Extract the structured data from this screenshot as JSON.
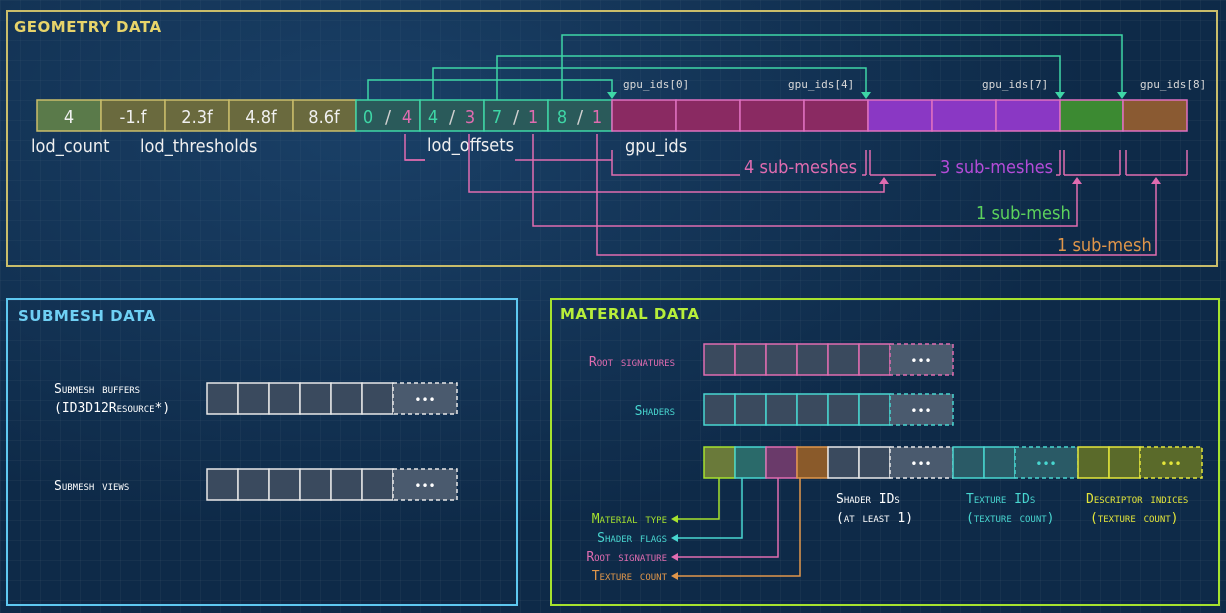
{
  "geometry": {
    "title": "GEOMETRY DATA",
    "lod_count_value": "4",
    "thresholds": [
      "-1.f",
      "2.3f",
      "4.8f",
      "8.6f"
    ],
    "offset_pairs": [
      [
        "0",
        "4"
      ],
      [
        "4",
        "3"
      ],
      [
        "7",
        "1"
      ],
      [
        "8",
        "1"
      ]
    ],
    "labels": {
      "lod_count": "lod_count",
      "lod_thresholds": "lod_thresholds",
      "lod_offsets": "lod_offsets",
      "gpu_ids": "gpu_ids"
    },
    "gpu_index_labels": [
      "gpu_ids[0]",
      "gpu_ids[4]",
      "gpu_ids[7]",
      "gpu_ids[8]"
    ],
    "group_labels": [
      "4 sub-meshes",
      "3 sub-meshes",
      "1 sub-mesh",
      "1 sub-mesh"
    ]
  },
  "submesh": {
    "title": "SUBMESH DATA",
    "buffers_label": [
      "Submesh buffers",
      "(ID3D12Resource*)"
    ],
    "views_label": "Submesh views",
    "ellipsis": "•••"
  },
  "material": {
    "title": "MATERIAL DATA",
    "root_signatures": "Root signatures",
    "shaders": "Shaders",
    "shader_ids": [
      "Shader IDs",
      "(at least 1)"
    ],
    "texture_ids": [
      "Texture IDs",
      "(texture count)"
    ],
    "descriptor_indices": [
      "Descriptor indices",
      "(texture count)"
    ],
    "fields": [
      "Material type",
      "Shader flags",
      "Root signature",
      "Texture count"
    ],
    "ellipsis": "•••"
  },
  "colors": {
    "geometry": "#d2c664",
    "submesh": "#5ec8f0",
    "material": "#a6e22e",
    "teal": "#3ed6a6",
    "pink": "#e06cb0",
    "purple": "#b44cd8",
    "green": "#5cd25c",
    "orange": "#e0964a",
    "cyan": "#48d6d0",
    "yellow": "#e4e63a"
  }
}
